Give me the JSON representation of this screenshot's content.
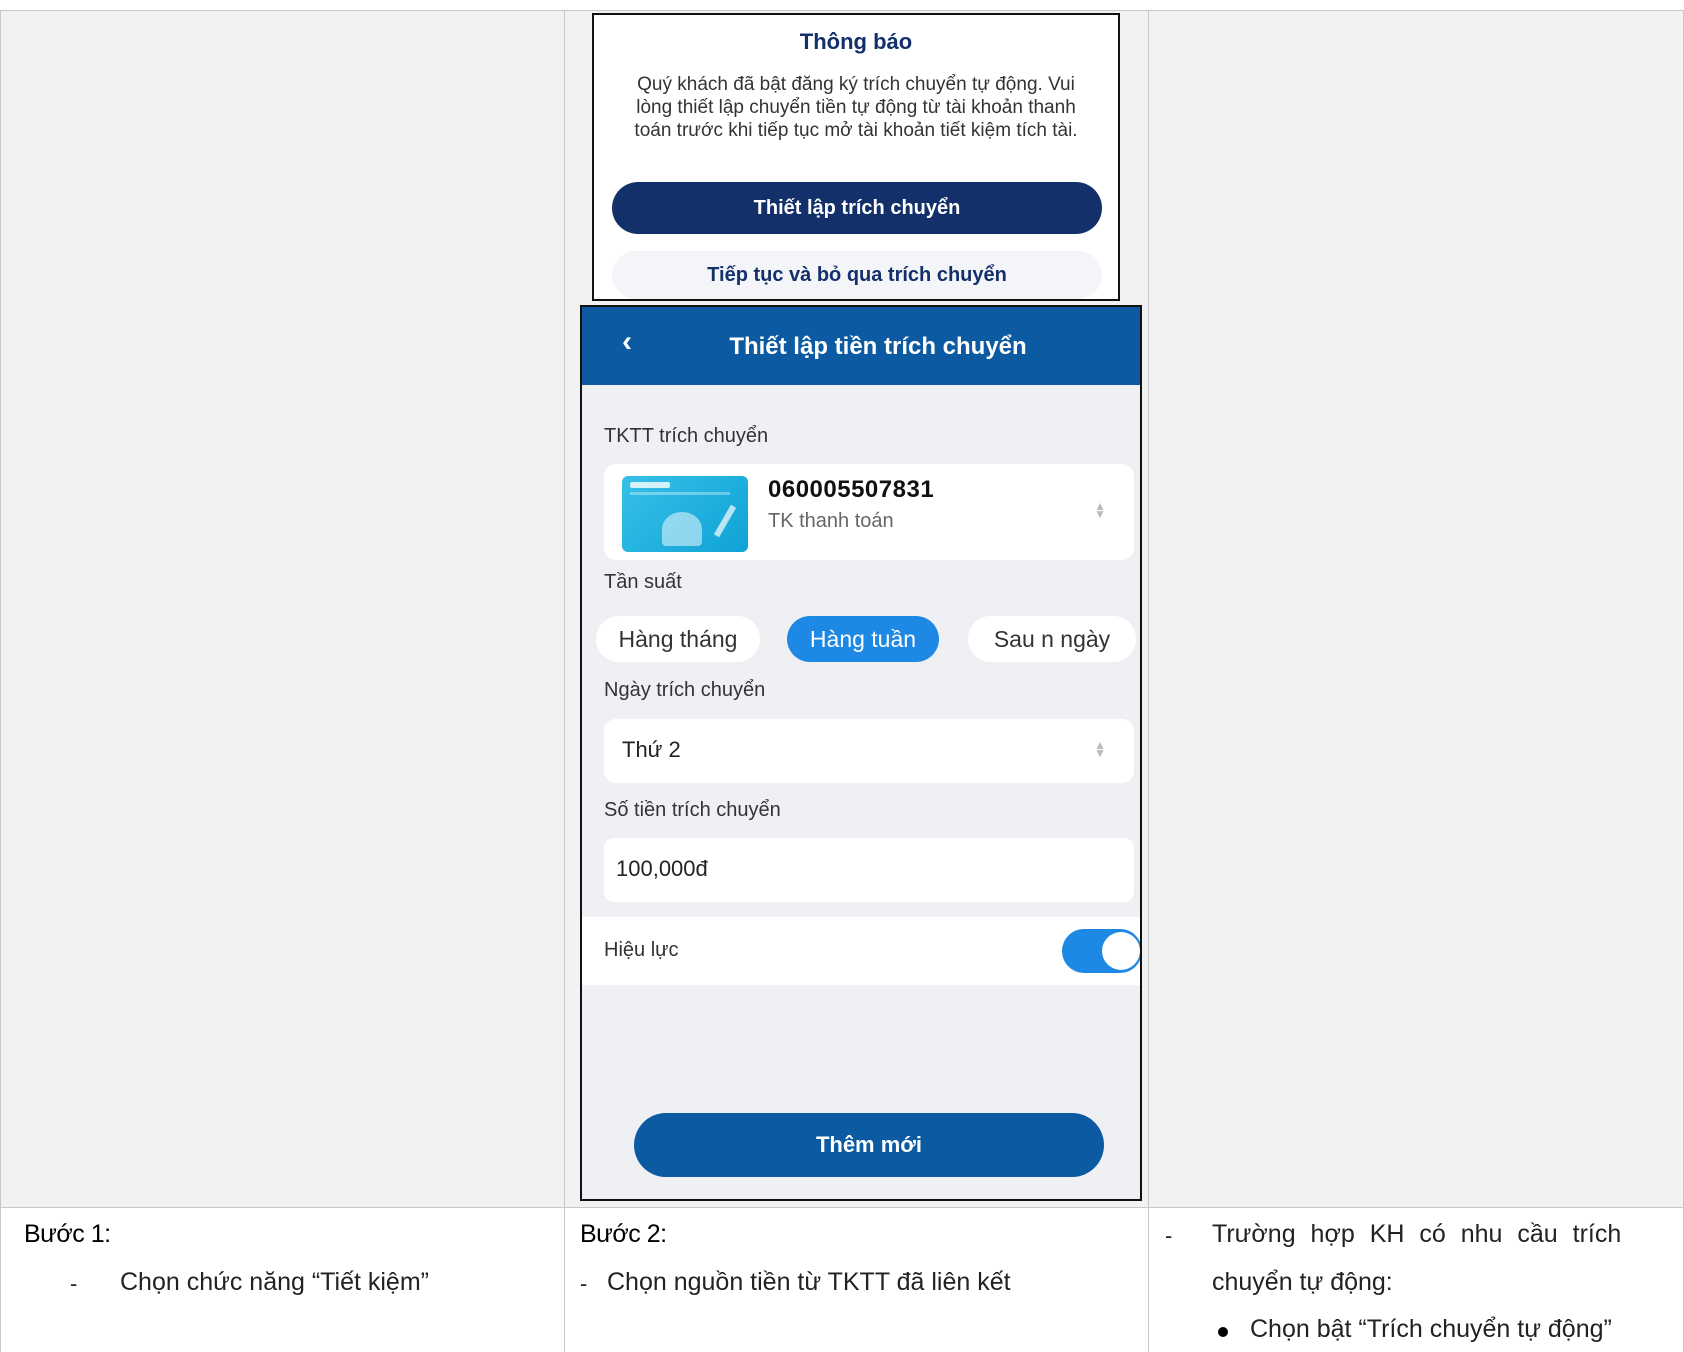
{
  "dialog": {
    "title": "Thông báo",
    "message": "Quý khách đã bật đăng ký trích chuyển tự động. Vui lòng thiết lập chuyển tiền tự động từ tài khoản thanh toán trước khi tiếp tục mở tài khoản tiết kiệm tích tài.",
    "primary_button": "Thiết lập trích chuyển",
    "secondary_button": "Tiếp tục và bỏ qua trích chuyển"
  },
  "screen": {
    "back_icon": "‹",
    "title": "Thiết lập tiền trích chuyển",
    "source_label": "TKTT trích chuyển",
    "account": {
      "number": "060005507831",
      "type": "TK thanh toán"
    },
    "frequency_label": "Tần suất",
    "frequency_options": [
      "Hàng tháng",
      "Hàng tuần",
      "Sau n ngày"
    ],
    "frequency_selected": "Hàng tuần",
    "date_label": "Ngày trích chuyển",
    "date_value": "Thứ 2",
    "amount_label": "Số tiền trích chuyển",
    "amount_value": "100,000đ",
    "effect_label": "Hiệu lực",
    "effect_on": true,
    "add_button": "Thêm mới"
  },
  "steps": {
    "step1": {
      "title": "Bước 1:",
      "dash": "-",
      "text": "Chọn chức năng “Tiết kiệm”"
    },
    "step2": {
      "title": "Bước 2:",
      "dash": "-",
      "text": "Chọn nguồn tiền từ TKTT đã liên kết"
    },
    "step3": {
      "dash": "-",
      "line1": "Trường hợp KH có nhu cầu trích",
      "line2": "chuyển tự động:",
      "bullet": "Chọn bật “Trích chuyển tự động”"
    }
  },
  "colors": {
    "navy": "#14306b",
    "header_blue": "#0b5aa2",
    "accent_blue": "#1e88e5",
    "cell_gray": "#f2f2f2"
  }
}
